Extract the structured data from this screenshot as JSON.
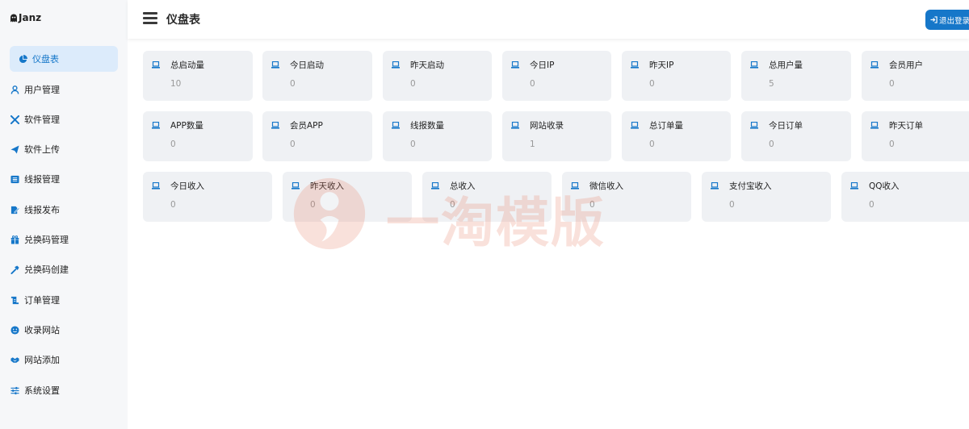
{
  "brand": {
    "name": "Janz"
  },
  "header": {
    "title": "仪盘表",
    "logout_label": "退出登录"
  },
  "sidebar": {
    "items": [
      {
        "label": "仪盘表",
        "icon": "pie-chart-icon",
        "active": true
      },
      {
        "label": "用户管理",
        "icon": "user-icon"
      },
      {
        "label": "软件管理",
        "icon": "tools-icon"
      },
      {
        "label": "软件上传",
        "icon": "paper-plane-icon"
      },
      {
        "label": "线报管理",
        "icon": "list-icon"
      },
      {
        "label": "线报发布",
        "icon": "edit-icon"
      },
      {
        "label": "兑换码管理",
        "icon": "gift-icon"
      },
      {
        "label": "兑换码创建",
        "icon": "hammer-icon"
      },
      {
        "label": "订单管理",
        "icon": "receipt-icon"
      },
      {
        "label": "收录网站",
        "icon": "smile-icon"
      },
      {
        "label": "网站添加",
        "icon": "handshake-icon"
      },
      {
        "label": "系统设置",
        "icon": "sliders-icon"
      }
    ]
  },
  "stats": {
    "row1": [
      {
        "label": "总启动量",
        "value": "10"
      },
      {
        "label": "今日启动",
        "value": "0"
      },
      {
        "label": "昨天启动",
        "value": "0"
      },
      {
        "label": "今日IP",
        "value": "0"
      },
      {
        "label": "昨天IP",
        "value": "0"
      },
      {
        "label": "总用户量",
        "value": "5"
      },
      {
        "label": "会员用户",
        "value": "0"
      }
    ],
    "row2": [
      {
        "label": "APP数量",
        "value": "0"
      },
      {
        "label": "会员APP",
        "value": "0"
      },
      {
        "label": "线报数量",
        "value": "0"
      },
      {
        "label": "网站收录",
        "value": "1"
      },
      {
        "label": "总订单量",
        "value": "0"
      },
      {
        "label": "今日订单",
        "value": "0"
      },
      {
        "label": "昨天订单",
        "value": "0"
      }
    ],
    "row3": [
      {
        "label": "今日收入",
        "value": "0"
      },
      {
        "label": "昨天收入",
        "value": "0"
      },
      {
        "label": "总收入",
        "value": "0"
      },
      {
        "label": "微信收入",
        "value": "0"
      },
      {
        "label": "支付宝收入",
        "value": "0"
      },
      {
        "label": "QQ收入",
        "value": "0"
      }
    ]
  },
  "watermark": {
    "text": "一淘模版"
  },
  "colors": {
    "accent": "#1677c9",
    "card_bg": "#eff1f4",
    "sidebar_bg": "#f6f7f9",
    "active_bg": "#dcebfb"
  }
}
